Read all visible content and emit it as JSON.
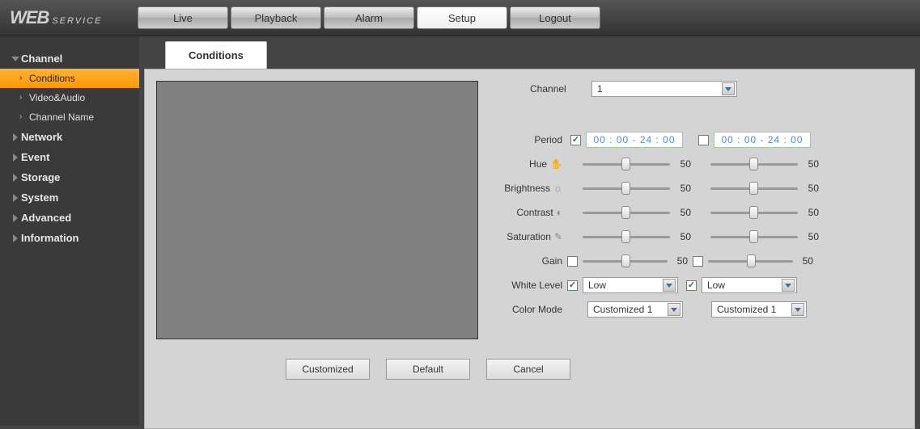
{
  "logo": {
    "web": "WEB",
    "service": "SERVICE"
  },
  "topnav": {
    "items": [
      "Live",
      "Playback",
      "Alarm",
      "Setup",
      "Logout"
    ],
    "active": "Setup"
  },
  "sidebar": {
    "groups": [
      {
        "label": "Channel",
        "expanded": true,
        "subs": [
          {
            "label": "Conditions",
            "active": true
          },
          {
            "label": "Video&Audio",
            "active": false
          },
          {
            "label": "Channel Name",
            "active": false
          }
        ]
      },
      {
        "label": "Network",
        "expanded": false
      },
      {
        "label": "Event",
        "expanded": false
      },
      {
        "label": "Storage",
        "expanded": false
      },
      {
        "label": "System",
        "expanded": false
      },
      {
        "label": "Advanced",
        "expanded": false
      },
      {
        "label": "Information",
        "expanded": false
      }
    ]
  },
  "tab": {
    "label": "Conditions"
  },
  "form": {
    "channel_label": "Channel",
    "channel_value": "1",
    "period_label": "Period",
    "period_a": {
      "enabled": true,
      "value": "00 : 00 - 24 : 00"
    },
    "period_b": {
      "enabled": false,
      "value": "00 : 00 - 24 : 00"
    },
    "rows": [
      {
        "label": "Hue",
        "icon": "hue-icon",
        "a": 50,
        "b": 50
      },
      {
        "label": "Brightness",
        "icon": "brightness-icon",
        "a": 50,
        "b": 50
      },
      {
        "label": "Contrast",
        "icon": "contrast-icon",
        "a": 50,
        "b": 50
      },
      {
        "label": "Saturation",
        "icon": "saturation-icon",
        "a": 50,
        "b": 50
      }
    ],
    "gain": {
      "label": "Gain",
      "a_checked": false,
      "a": 50,
      "b_checked": false,
      "b": 50
    },
    "whitelevel": {
      "label": "White Level",
      "a_checked": true,
      "a_value": "Low",
      "b_checked": true,
      "b_value": "Low"
    },
    "colormode": {
      "label": "Color Mode",
      "a_value": "Customized 1",
      "b_value": "Customized 1"
    }
  },
  "buttons": {
    "customized": "Customized",
    "default": "Default",
    "cancel": "Cancel"
  }
}
